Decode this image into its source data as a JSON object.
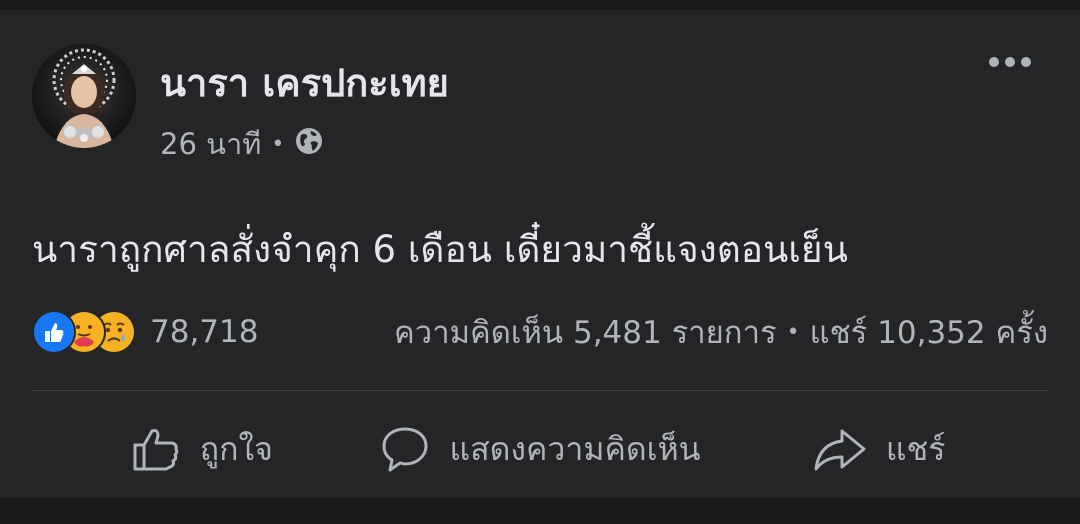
{
  "post": {
    "author_name": "นารา เครปกะเทย",
    "time_ago": "26 นาที",
    "dot": "•",
    "privacy_icon": "globe-icon",
    "message": "นาราถูกศาลสั่งจำคุก 6 เดือน เดี๋ยวมาชี้แจงตอนเย็น",
    "reactions": {
      "icons": [
        "like-icon",
        "care-icon",
        "sad-icon"
      ],
      "count": "78,718"
    },
    "comments_text": "ความคิดเห็น 5,481 รายการ",
    "shares_text": "แชร์ 10,352 ครั้ง"
  },
  "actions": {
    "like_label": "ถูกใจ",
    "comment_label": "แสดงความคิดเห็น",
    "share_label": "แชร์"
  },
  "colors": {
    "page_bg": "#18191a",
    "card_bg": "#242526",
    "primary_text": "#e4e6eb",
    "secondary_text": "#b0b3b8",
    "like_blue": "#1877f2"
  }
}
